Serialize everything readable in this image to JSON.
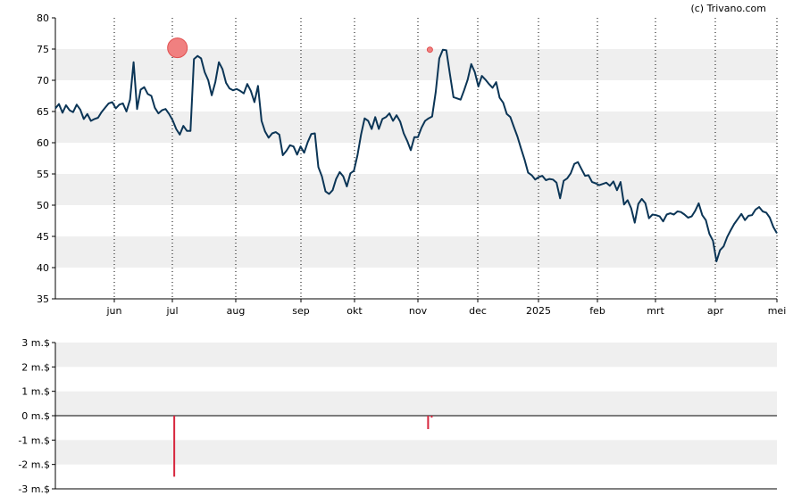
{
  "credit": "(c) Trivano.com",
  "chart_data": [
    {
      "type": "line",
      "title": "",
      "xlabel": "",
      "ylabel": "",
      "ylim": [
        35,
        80
      ],
      "y_ticks": [
        35,
        40,
        45,
        50,
        55,
        60,
        65,
        70,
        75,
        80
      ],
      "x_ticks": [
        "jun",
        "jul",
        "aug",
        "sep",
        "okt",
        "nov",
        "dec",
        "2025",
        "feb",
        "mrt",
        "apr",
        "mei"
      ],
      "grid": "horizontal bands + dotted monthly verticals",
      "colors": {
        "line": "#0b3556",
        "marker": "#f08080",
        "band": "#efefef"
      },
      "series": [
        {
          "values": [
            65.5,
            66.2,
            64.8,
            66.0,
            65.2,
            64.9,
            66.1,
            65.3,
            63.8,
            64.6,
            63.5,
            63.8,
            64.0,
            64.9,
            65.6,
            66.3,
            66.5,
            65.5,
            66.1,
            66.3,
            65.0,
            66.9,
            72.9,
            65.4,
            68.5,
            68.9,
            67.8,
            67.5,
            65.6,
            64.7,
            65.2,
            65.4,
            64.6,
            63.6,
            62.2,
            61.3,
            62.7,
            61.9,
            61.9,
            73.4,
            73.9,
            73.5,
            71.3,
            70.0,
            67.6,
            69.7,
            72.9,
            71.8,
            69.6,
            68.7,
            68.4,
            68.6,
            68.3,
            67.9,
            69.4,
            68.3,
            66.5,
            69.1,
            63.5,
            61.8,
            60.8,
            61.5,
            61.7,
            61.3,
            58.0,
            58.7,
            59.6,
            59.4,
            58.1,
            59.4,
            58.4,
            60.1,
            61.4,
            61.5,
            56.1,
            54.6,
            52.2,
            51.8,
            52.4,
            54.2,
            55.3,
            54.6,
            53.0,
            55.1,
            55.5,
            58.0,
            61.3,
            63.9,
            63.5,
            62.2,
            64.1,
            62.2,
            63.8,
            64.1,
            64.7,
            63.5,
            64.4,
            63.4,
            61.5,
            60.3,
            58.8,
            60.9,
            60.9,
            62.4,
            63.5,
            63.9,
            64.2,
            68.1,
            73.5,
            74.9,
            74.8,
            71.0,
            67.3,
            67.1,
            66.9,
            68.4,
            70.1,
            72.6,
            71.3,
            69.0,
            70.7,
            70.1,
            69.4,
            68.8,
            69.7,
            67.2,
            66.4,
            64.6,
            64.1,
            62.5,
            61.0,
            59.1,
            57.3,
            55.2,
            54.8,
            54.1,
            54.5,
            54.7,
            54.0,
            54.2,
            54.1,
            53.6,
            51.1,
            53.9,
            54.3,
            55.1,
            56.6,
            56.9,
            55.8,
            54.7,
            54.8,
            53.7,
            53.5,
            53.2,
            53.4,
            53.6,
            53.1,
            53.8,
            52.4,
            53.7,
            50.1,
            50.8,
            49.5,
            47.2,
            50.2,
            51.0,
            50.3,
            47.9,
            48.5,
            48.4,
            48.2,
            47.4,
            48.5,
            48.7,
            48.5,
            49.0,
            48.9,
            48.5,
            48.0,
            48.2,
            49.1,
            50.3,
            48.4,
            47.6,
            45.4,
            44.3,
            41.0,
            42.8,
            43.4,
            44.9,
            46.0,
            47.0,
            47.8,
            48.6,
            47.6,
            48.3,
            48.4,
            49.3,
            49.7,
            49.0,
            48.8,
            48.0,
            46.5,
            45.5
          ]
        }
      ],
      "events": [
        {
          "month_pos": 1.08,
          "value": 75.2
        },
        {
          "month_pos": 5.2,
          "value": 74.9
        }
      ]
    },
    {
      "type": "bar",
      "title": "",
      "ylim": [
        -3,
        3
      ],
      "y_ticks": [
        -3,
        -2,
        -1,
        0,
        1,
        2,
        3
      ],
      "y_tick_labels": [
        "-3 m.$",
        "-2 m.$",
        "-1 m.$",
        "0 m.$",
        "1 m.$",
        "2 m.$",
        "3 m.$"
      ],
      "colors": {
        "bar": "#d7263d",
        "band": "#efefef"
      },
      "bars": [
        {
          "month_pos": 1.03,
          "value": -2.5
        },
        {
          "month_pos": 5.17,
          "value": -0.55
        },
        {
          "month_pos": 5.23,
          "value": -0.08
        }
      ]
    }
  ]
}
